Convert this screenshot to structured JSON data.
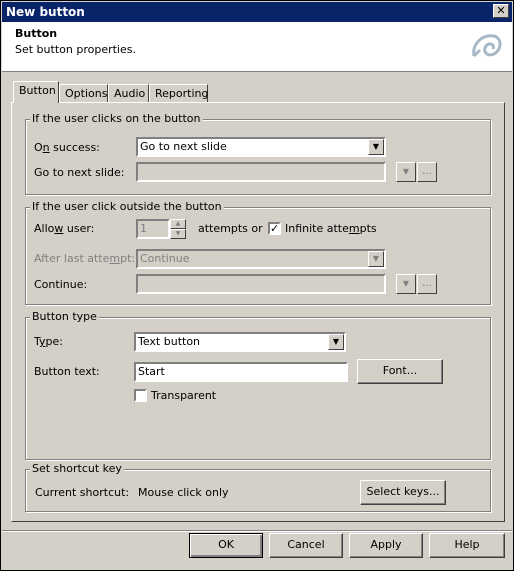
{
  "window": {
    "title": "New button",
    "close_glyph": "✕"
  },
  "header": {
    "title": "Button",
    "subtitle": "Set button properties."
  },
  "tabs": [
    {
      "label": "Button",
      "active": true
    },
    {
      "label": "Options",
      "active": false
    },
    {
      "label": "Audio",
      "active": false
    },
    {
      "label": "Reporting",
      "active": false
    }
  ],
  "success_group": {
    "title": "If the user clicks on the button",
    "on_success_label_pre": "O",
    "on_success_label_u": "n",
    "on_success_label_post": " success:",
    "on_success_value": "Go to next slide",
    "goto_label": "Go to next slide:",
    "goto_value": ""
  },
  "outside_group": {
    "title": "If the user click outside the button",
    "allow_label_pre": "Allo",
    "allow_label_u": "w",
    "allow_label_post": " user:",
    "allow_value": "1",
    "attempts_label": "attempts or",
    "infinite_checked": true,
    "infinite_label_pre": "Infinite atte",
    "infinite_label_u": "m",
    "infinite_label_post": "pts",
    "after_label_pre": "After last atte",
    "after_label_u": "m",
    "after_label_post": "pt:",
    "after_value": "Continue",
    "continue_label": "Continue:",
    "continue_value": ""
  },
  "type_group": {
    "title": "Button type",
    "type_label_pre": "T",
    "type_label_u": "y",
    "type_label_post": "pe:",
    "type_value": "Text button",
    "text_label": "Button text:",
    "text_value": "Start",
    "font_button": "Font...",
    "transparent_label": "Transparent",
    "transparent_checked": false
  },
  "shortcut_group": {
    "title": "Set shortcut key",
    "current_label": "Current shortcut:",
    "current_value": "Mouse click only",
    "select_keys_button": "Select keys..."
  },
  "footer": {
    "ok": "OK",
    "cancel": "Cancel",
    "apply": "Apply",
    "help": "Help"
  },
  "colors": {
    "titlebar": "#0a246a",
    "face": "#d4d0c8"
  }
}
